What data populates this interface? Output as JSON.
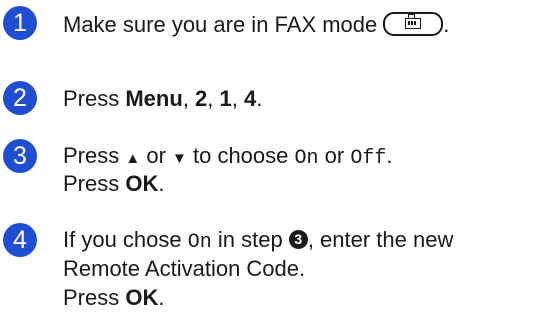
{
  "steps": [
    {
      "number": "1",
      "text": "Make sure you are in FAX mode",
      "suffix": "."
    },
    {
      "number": "2",
      "pre": "Press ",
      "menu": "Menu",
      "sep1": ", ",
      "k2": "2",
      "sep2": ", ",
      "k1": "1",
      "sep3": ", ",
      "k4": "4",
      "end": "."
    },
    {
      "number": "3",
      "line1_pre": "Press ",
      "up": "▲",
      "or1": " or ",
      "down": "▼",
      "mid": " to choose ",
      "on": "On",
      "or2": " or ",
      "off": "Off",
      "end": ".",
      "line2_pre": "Press ",
      "ok": "OK",
      "line2_end": "."
    },
    {
      "number": "4",
      "line1_pre": "If you chose ",
      "on": "On",
      "mid": " in step ",
      "ref": "3",
      "post": ", enter the new",
      "line2": "Remote Activation Code.",
      "line3_pre": "Press ",
      "ok": "OK",
      "line3_end": "."
    }
  ],
  "colors": {
    "badge": "#1f4fd0"
  },
  "icons": {
    "fax_key": "fax-mode-key-icon"
  }
}
